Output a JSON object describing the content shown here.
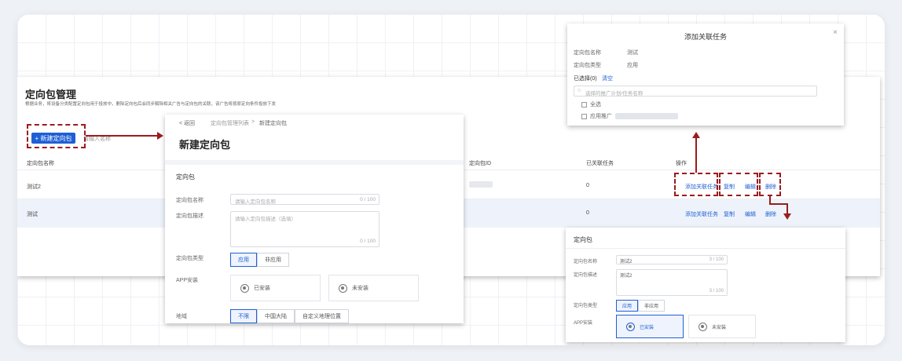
{
  "main_page": {
    "title": "定向包管理",
    "desc": "根据业务，将设备分类配置定向包用于投放中，删除定向包后会同步解除相关广告与定向包的关联，该广告将按原定向条件投放下发",
    "new_button": "+ 新建定向包",
    "search_placeholder": "请输入名称",
    "columns": [
      "定向包名称",
      "定向包ID",
      "已关联任务",
      "操作"
    ],
    "rows": [
      {
        "name": "测试2",
        "id": "",
        "tasks": "0"
      },
      {
        "name": "测试",
        "id": "",
        "tasks": "0"
      }
    ],
    "actions": {
      "link": "添加关联任务",
      "copy": "复制",
      "edit": "编辑",
      "delete": "删除"
    }
  },
  "create_panel": {
    "back": "< 返回",
    "breadcrumb_parent": "定向包管理列表",
    "breadcrumb_sep": ">",
    "breadcrumb_current": "新建定向包",
    "title": "新建定向包",
    "section": "定向包",
    "name_label": "定向包名称",
    "name_placeholder": "请输入定向包名称",
    "name_count": "0 / 100",
    "desc_label": "定向包描述",
    "desc_placeholder": "请输入定向包描述（选填）",
    "desc_count": "0 / 100",
    "type_label": "定向包类型",
    "type_options": [
      "应用",
      "非应用"
    ],
    "app_label": "APP安装",
    "app_options": [
      "已安装",
      "未安装"
    ],
    "region_label": "地域",
    "region_options": [
      "不限",
      "中国大陆",
      "自定义地理位置"
    ]
  },
  "link_dialog": {
    "title": "添加关联任务",
    "close": "×",
    "name_label": "定向包名称",
    "name_value": "测试",
    "type_label": "定向包类型",
    "type_value": "应用",
    "selected_label": "已选择(0)",
    "clear": "清空",
    "search_placeholder": "选择的推广计划/任务名称",
    "select_all": "全选",
    "item_prefix": "应用推广"
  },
  "edit_panel": {
    "section": "定向包",
    "name_label": "定向包名称",
    "name_value": "测试2",
    "name_count": "3 / 100",
    "desc_label": "定向包描述",
    "desc_value": "测试2",
    "desc_count": "3 / 100",
    "type_label": "定向包类型",
    "type_options": [
      "应用",
      "非应用"
    ],
    "app_label": "APP安装",
    "app_options": [
      "已安装",
      "未安装"
    ]
  },
  "colors": {
    "accent": "#1f5fd6",
    "highlight": "#9b1c1c"
  }
}
